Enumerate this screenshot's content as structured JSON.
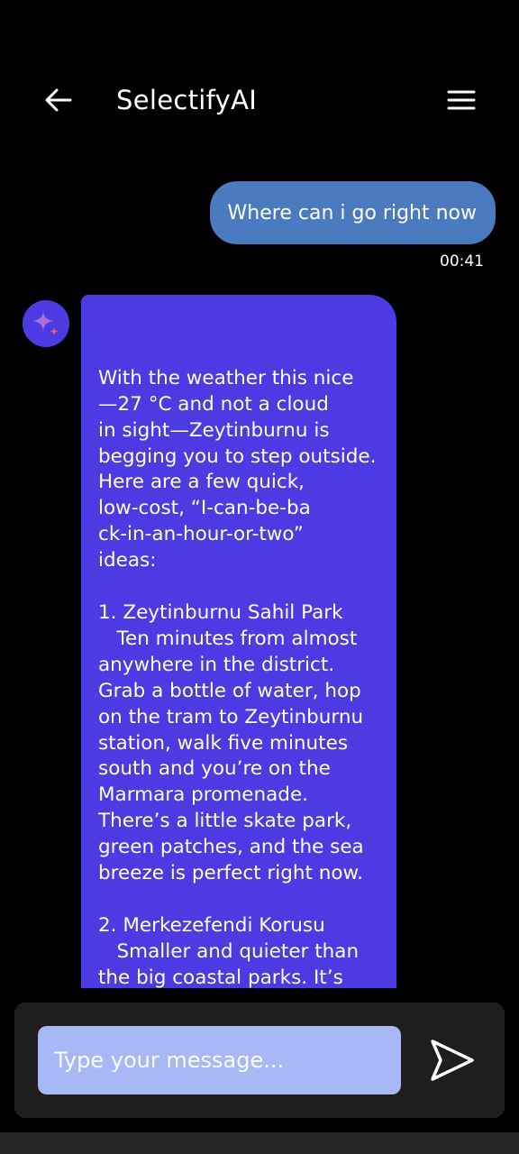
{
  "header": {
    "title": "SelectifyAI",
    "back_icon": "arrow-left-icon",
    "menu_icon": "hamburger-menu-icon"
  },
  "messages": {
    "user": {
      "text": "Where can i go right now",
      "time": "00:41"
    },
    "bot": {
      "avatar_icon": "sparkle-icon",
      "text": "With the weather this nice\n—27 °C and not a cloud\nin sight—Zeytinburnu is\nbegging you to step outside.\nHere are a few quick,\nlow-cost, “I-can-be-ba\nck-in-an-hour-or-two”\nideas:\n\n1. Zeytinburnu Sahil Park\n   Ten minutes from almost\nanywhere in the district.\nGrab a bottle of water, hop\non the tram to Zeytinburnu\nstation, walk five minutes\nsouth and you’re on the\nMarmara promenade.\nThere’s a little skate park,\ngreen patches, and the sea\nbreeze is perfect right now.\n\n2. Merkezefendi Korusu\n   Smaller and quieter than\nthe big coastal parks. It’s\nbasically a pine-scented\npocket of calm. If you’ve got"
    }
  },
  "composer": {
    "placeholder": "Type your message...",
    "send_icon": "send-icon"
  },
  "colors": {
    "background": "#000000",
    "user_bubble": "#4a7abf",
    "bot_bubble": "#4c3ae3",
    "input_bg": "#a6b8f5",
    "composer_bg": "#1e1e1e"
  }
}
